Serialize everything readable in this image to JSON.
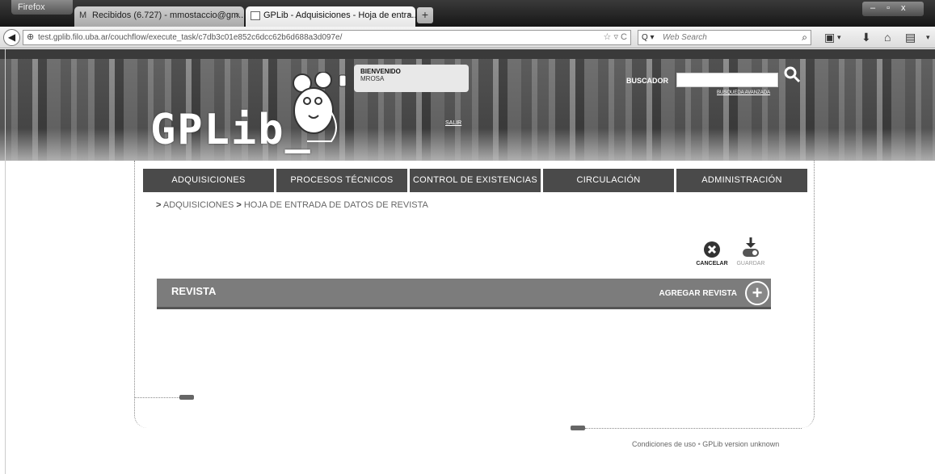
{
  "browser": {
    "firefox_button": "Firefox",
    "tabs": [
      {
        "title": "Recibidos (6.727) - mmostaccio@gm...",
        "favicon": "M",
        "active": false
      },
      {
        "title": "GPLib - Adquisiciones - Hoja de entra...",
        "favicon": "",
        "active": true
      }
    ],
    "new_tab": "+",
    "url": "test.gplib.filo.uba.ar/couchflow/execute_task/c7db3c01e852c6dcc62b6d688a3d097e/",
    "search_engine": "Q ▾",
    "search_placeholder": "Web Search"
  },
  "header": {
    "logo_text": "GPLib_",
    "welcome_title": "BIENVENIDO",
    "welcome_user": "MROSA",
    "logout": "SALIR",
    "search_label": "BUSCADOR",
    "search_value": "",
    "advanced_search": "BUSQUEDA AVANZADA"
  },
  "nav": {
    "items": [
      {
        "label": "ADQUISICIONES"
      },
      {
        "label": "PROCESOS TÉCNICOS"
      },
      {
        "label": "CONTROL DE EXISTENCIAS"
      },
      {
        "label": "CIRCULACIÓN"
      },
      {
        "label": "ADMINISTRACIÓN"
      }
    ]
  },
  "breadcrumb": {
    "items": [
      "ADQUISICIONES",
      "HOJA DE ENTRADA DE DATOS DE REVISTA"
    ]
  },
  "actions": {
    "cancel": "CANCELAR",
    "save": "GUARDAR"
  },
  "section": {
    "title": "REVISTA",
    "add_label": "AGREGAR REVISTA",
    "add_symbol": "+"
  },
  "footer": {
    "terms": "Condiciones de uso",
    "separator": "•",
    "version": "GPLib version unknown"
  },
  "colors": {
    "nav_bg": "#4a4a4a",
    "section_bg": "#7c7c7c",
    "breadcrumb_text": "#666666"
  }
}
